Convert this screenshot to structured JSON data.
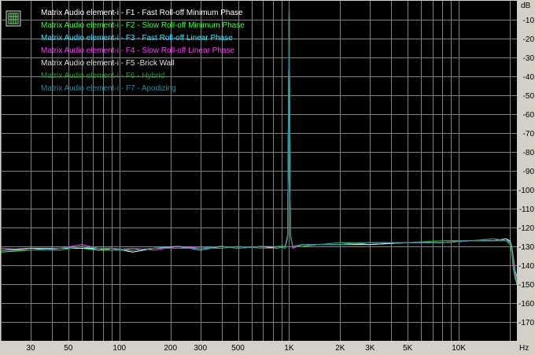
{
  "chart_data": {
    "type": "line",
    "title": "",
    "xlabel": "Hz",
    "ylabel": "dB",
    "x_scale": "log",
    "xlim": [
      20,
      22000
    ],
    "ylim": [
      -180,
      0
    ],
    "grid": true,
    "legend_position": "top-left",
    "background_color": "#000000",
    "grid_color": "#808080",
    "x_ticks": [
      {
        "value": 30,
        "label": "30"
      },
      {
        "value": 50,
        "label": "50"
      },
      {
        "value": 100,
        "label": "100"
      },
      {
        "value": 200,
        "label": "200"
      },
      {
        "value": 300,
        "label": "300"
      },
      {
        "value": 500,
        "label": "500"
      },
      {
        "value": 1000,
        "label": "1K"
      },
      {
        "value": 2000,
        "label": "2K"
      },
      {
        "value": 3000,
        "label": "3K"
      },
      {
        "value": 5000,
        "label": "5K"
      },
      {
        "value": 10000,
        "label": "10K"
      }
    ],
    "y_ticks": [
      {
        "value": -10,
        "label": "-10"
      },
      {
        "value": -20,
        "label": "-20"
      },
      {
        "value": -30,
        "label": "-30"
      },
      {
        "value": -40,
        "label": "-40"
      },
      {
        "value": -50,
        "label": "-50"
      },
      {
        "value": -60,
        "label": "-60"
      },
      {
        "value": -70,
        "label": "-70"
      },
      {
        "value": -80,
        "label": "-80"
      },
      {
        "value": -90,
        "label": "-90"
      },
      {
        "value": -100,
        "label": "-100"
      },
      {
        "value": -110,
        "label": "-110"
      },
      {
        "value": -120,
        "label": "-120"
      },
      {
        "value": -130,
        "label": "-130"
      },
      {
        "value": -140,
        "label": "-140"
      },
      {
        "value": -150,
        "label": "-150"
      },
      {
        "value": -160,
        "label": "-160"
      },
      {
        "value": -170,
        "label": "-170"
      }
    ],
    "series": [
      {
        "name": "Matrix Audio element-i - F1 - Fast Roll-off Minimum Phase",
        "color": "#ffffff",
        "x": [
          20,
          30,
          45,
          60,
          75,
          90,
          120,
          160,
          220,
          300,
          400,
          500,
          700,
          850,
          950,
          980,
          1000,
          1020,
          1050,
          1200,
          1500,
          2000,
          3000,
          5000,
          8000,
          12000,
          16000,
          19000,
          20000,
          20500,
          21000,
          21500,
          22000
        ],
        "y": [
          -132,
          -132,
          -131,
          -130,
          -132,
          -131,
          -133,
          -131,
          -130,
          -131,
          -130,
          -131,
          -130,
          -131,
          -130,
          -124,
          -3,
          -124,
          -130,
          -130,
          -129,
          -129,
          -129,
          -128,
          -128,
          -127,
          -126,
          -127,
          -128,
          -131,
          -140,
          -145,
          -147
        ]
      },
      {
        "name": "Matrix Audio element-i - F2 - Slow Roll-off Minimum Phase",
        "color": "#40ff40",
        "x": [
          20,
          30,
          45,
          60,
          75,
          90,
          120,
          160,
          220,
          300,
          400,
          500,
          700,
          850,
          950,
          980,
          1000,
          1020,
          1050,
          1200,
          1500,
          2000,
          3000,
          5000,
          8000,
          12000,
          16000,
          19000,
          20000,
          20500,
          21000,
          21500,
          22000
        ],
        "y": [
          -133,
          -132,
          -131,
          -131,
          -132,
          -132,
          -132,
          -131,
          -131,
          -131,
          -131,
          -130,
          -131,
          -130,
          -130,
          -125,
          -3,
          -125,
          -130,
          -129,
          -129,
          -129,
          -128,
          -128,
          -127,
          -127,
          -127,
          -127,
          -129,
          -133,
          -142,
          -147,
          -150
        ]
      },
      {
        "name": "Matrix Audio element-i - F3 - Fast Roll-off Linear Phase",
        "color": "#40e0ff",
        "x": [
          20,
          30,
          45,
          60,
          75,
          90,
          120,
          160,
          220,
          300,
          400,
          500,
          700,
          850,
          950,
          980,
          1000,
          1020,
          1050,
          1200,
          1500,
          2000,
          3000,
          5000,
          8000,
          12000,
          16000,
          19000,
          20000,
          20500,
          21000,
          21500,
          22000
        ],
        "y": [
          -132,
          -131,
          -132,
          -130,
          -132,
          -131,
          -132,
          -131,
          -130,
          -132,
          -130,
          -131,
          -130,
          -130,
          -131,
          -125,
          -3,
          -125,
          -130,
          -130,
          -129,
          -128,
          -129,
          -128,
          -128,
          -127,
          -127,
          -126,
          -128,
          -130,
          -138,
          -144,
          -148
        ]
      },
      {
        "name": "Matrix Audio element-i - F4 - Slow Roll-off Linear Phase",
        "color": "#ff40ff",
        "x": [
          20,
          30,
          45,
          60,
          75,
          90,
          120,
          160,
          220,
          300,
          400,
          500,
          700,
          850,
          950,
          980,
          1000,
          1020,
          1050,
          1200,
          1500,
          2000,
          3000,
          5000,
          8000,
          12000,
          16000,
          19000,
          20000,
          20500,
          21000,
          21500,
          22000
        ],
        "y": [
          -131,
          -132,
          -131,
          -129,
          -131,
          -132,
          -131,
          -132,
          -130,
          -131,
          -131,
          -130,
          -131,
          -130,
          -131,
          -124,
          -3,
          -124,
          -131,
          -129,
          -129,
          -129,
          -128,
          -128,
          -128,
          -127,
          -127,
          -127,
          -128,
          -132,
          -141,
          -146,
          -149
        ]
      },
      {
        "name": "Matrix Audio element-i - F5 -Brick Wall",
        "color": "#e0e0e0",
        "x": [
          20,
          30,
          45,
          60,
          75,
          90,
          120,
          160,
          220,
          300,
          400,
          500,
          700,
          850,
          950,
          980,
          1000,
          1020,
          1050,
          1200,
          1500,
          2000,
          3000,
          5000,
          8000,
          12000,
          16000,
          19000,
          20000,
          20500,
          21000,
          21500,
          22000
        ],
        "y": [
          -132,
          -131,
          -131,
          -131,
          -131,
          -131,
          -132,
          -131,
          -131,
          -131,
          -130,
          -131,
          -130,
          -131,
          -130,
          -124,
          -3,
          -124,
          -130,
          -129,
          -129,
          -129,
          -129,
          -128,
          -128,
          -127,
          -127,
          -126,
          -127,
          -130,
          -136,
          -143,
          -146
        ]
      },
      {
        "name": "Matrix Audio element-i - F6 - Hybrid",
        "color": "#2e9a2e",
        "x": [
          20,
          30,
          45,
          60,
          75,
          90,
          120,
          160,
          220,
          300,
          400,
          500,
          700,
          850,
          950,
          980,
          1000,
          1020,
          1050,
          1200,
          1500,
          2000,
          3000,
          5000,
          8000,
          12000,
          16000,
          19000,
          20000,
          20500,
          21000,
          21500,
          22000
        ],
        "y": [
          -132,
          -132,
          -132,
          -130,
          -131,
          -132,
          -132,
          -131,
          -131,
          -131,
          -131,
          -130,
          -131,
          -131,
          -130,
          -125,
          -3,
          -125,
          -130,
          -130,
          -129,
          -128,
          -128,
          -128,
          -127,
          -127,
          -127,
          -127,
          -129,
          -132,
          -139,
          -145,
          -148
        ]
      },
      {
        "name": "Matrix Audio element-i - F7 - Apodizing",
        "color": "#2a8a9a",
        "x": [
          20,
          30,
          45,
          60,
          75,
          90,
          120,
          160,
          220,
          300,
          400,
          500,
          700,
          850,
          950,
          980,
          1000,
          1020,
          1050,
          1200,
          1500,
          2000,
          3000,
          5000,
          8000,
          12000,
          16000,
          19000,
          20000,
          20500,
          21000,
          21500,
          22000
        ],
        "y": [
          -132,
          -132,
          -131,
          -130,
          -131,
          -131,
          -132,
          -131,
          -131,
          -131,
          -130,
          -131,
          -130,
          -130,
          -131,
          -124,
          -3,
          -124,
          -130,
          -129,
          -129,
          -129,
          -128,
          -128,
          -128,
          -127,
          -126,
          -127,
          -128,
          -131,
          -137,
          -144,
          -147
        ]
      }
    ]
  }
}
